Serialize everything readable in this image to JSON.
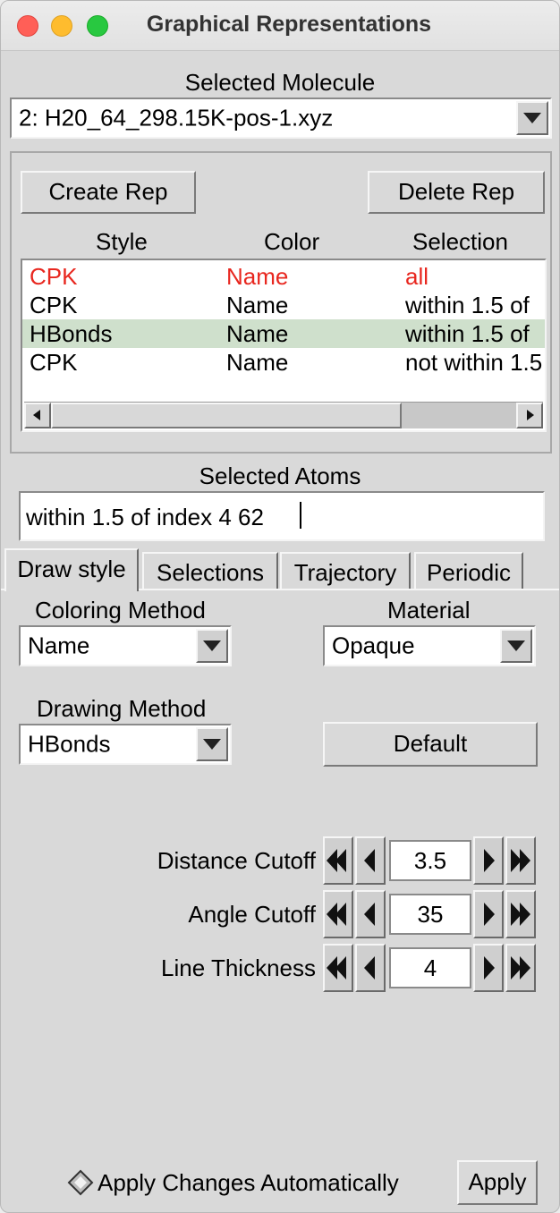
{
  "window": {
    "title": "Graphical Representations"
  },
  "molecule": {
    "label": "Selected Molecule",
    "value": "2: H20_64_298.15K-pos-1.xyz"
  },
  "reps": {
    "create_label": "Create Rep",
    "delete_label": "Delete Rep",
    "columns": [
      "Style",
      "Color",
      "Selection"
    ],
    "rows": [
      {
        "style": "CPK",
        "color": "Name",
        "selection": "all"
      },
      {
        "style": "CPK",
        "color": "Name",
        "selection": "within 1.5 of"
      },
      {
        "style": "HBonds",
        "color": "Name",
        "selection": "within 1.5 of"
      },
      {
        "style": "CPK",
        "color": "Name",
        "selection": "not within 1.5"
      }
    ],
    "first_row_color": "#e8271f",
    "selected_row_bg": "#cfe0cc"
  },
  "atoms": {
    "label": "Selected Atoms",
    "value": "within 1.5 of index 4 62"
  },
  "tabs": [
    "Draw style",
    "Selections",
    "Trajectory",
    "Periodic"
  ],
  "draw": {
    "coloring_label": "Coloring Method",
    "coloring_value": "Name",
    "material_label": "Material",
    "material_value": "Opaque",
    "drawing_label": "Drawing Method",
    "drawing_value": "HBonds",
    "default_label": "Default"
  },
  "params": [
    {
      "label": "Distance Cutoff",
      "value": "3.5"
    },
    {
      "label": "Angle Cutoff",
      "value": "35"
    },
    {
      "label": "Line Thickness",
      "value": "4"
    }
  ],
  "footer": {
    "auto_label": "Apply Changes Automatically",
    "apply_label": "Apply"
  },
  "colors": {
    "close": "#ff5f57",
    "minimize": "#febc2e",
    "zoom": "#28c840"
  }
}
